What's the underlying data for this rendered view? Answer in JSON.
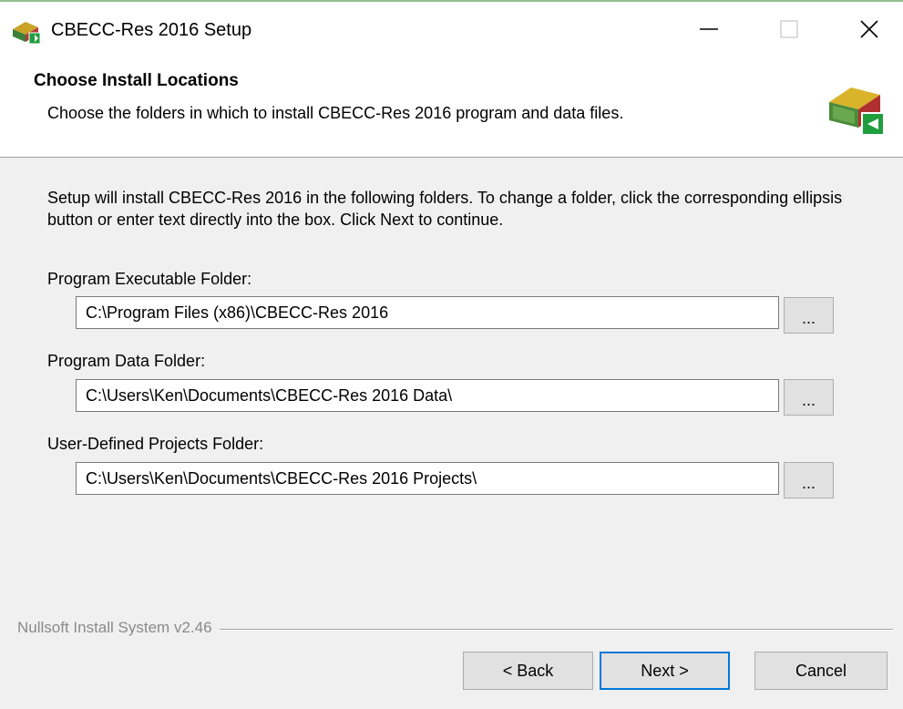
{
  "window": {
    "title": "CBECC-Res 2016 Setup"
  },
  "header": {
    "title": "Choose Install Locations",
    "subtitle": "Choose the folders in which to install CBECC-Res 2016 program and data files."
  },
  "body": {
    "instructions": "Setup will install CBECC-Res 2016 in the following folders. To change a folder, click the corresponding ellipsis button or enter text directly into the box. Click Next to continue."
  },
  "fields": [
    {
      "label": "Program Executable Folder:",
      "value": "C:\\Program Files (x86)\\CBECC-Res 2016",
      "browse_label": "..."
    },
    {
      "label": "Program Data Folder:",
      "value": "C:\\Users\\Ken\\Documents\\CBECC-Res 2016 Data\\",
      "browse_label": "..."
    },
    {
      "label": "User-Defined Projects Folder:",
      "value": "C:\\Users\\Ken\\Documents\\CBECC-Res 2016 Projects\\",
      "browse_label": "..."
    }
  ],
  "footer": {
    "branding": "Nullsoft Install System v2.46",
    "back_label": "< Back",
    "next_label": "Next >",
    "cancel_label": "Cancel"
  },
  "icons": {
    "app": "installer-house-icon",
    "header": "installer-house-arrow-icon",
    "minimize": "minimize-icon",
    "maximize": "maximize-icon",
    "close": "close-icon"
  },
  "colors": {
    "focus_border": "#0078d7",
    "dialog_background": "#f0f0f0",
    "header_background": "#ffffff"
  }
}
